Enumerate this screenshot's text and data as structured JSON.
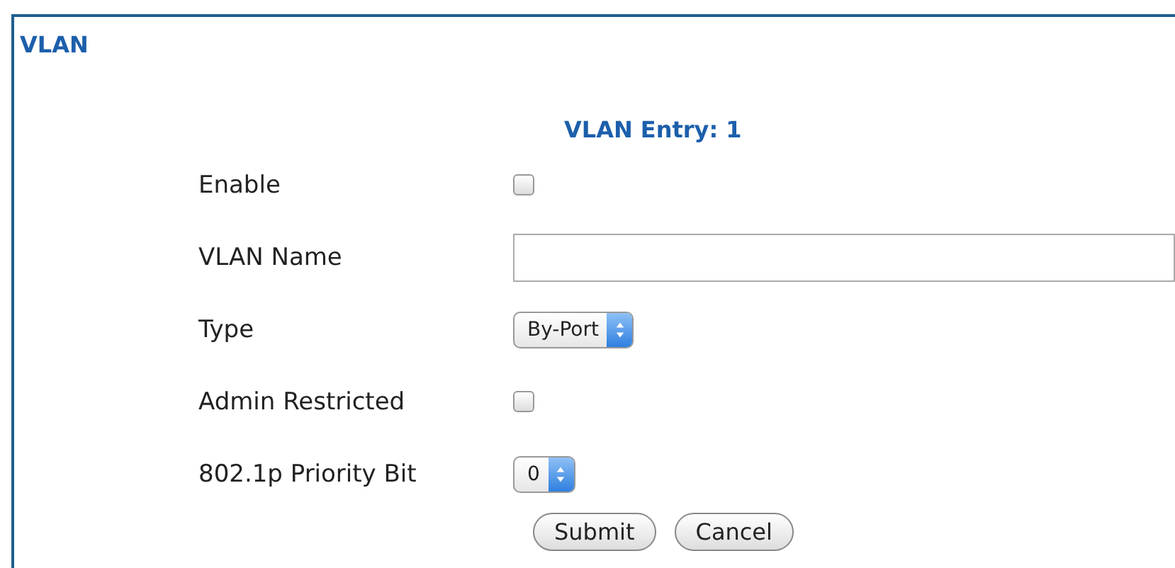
{
  "panel": {
    "title": "VLAN"
  },
  "heading": "VLAN Entry: 1",
  "rows": [
    {
      "label": "Enable",
      "kind": "checkbox",
      "checked": false
    },
    {
      "label": "VLAN Name",
      "kind": "text"
    },
    {
      "label": "Type",
      "kind": "select",
      "value": "By-Port"
    },
    {
      "label": "Admin Restricted",
      "kind": "checkbox",
      "checked": false
    },
    {
      "label": "802.1p Priority Bit",
      "kind": "select",
      "value": "0"
    }
  ],
  "buttons": [
    "Submit",
    "Cancel"
  ]
}
